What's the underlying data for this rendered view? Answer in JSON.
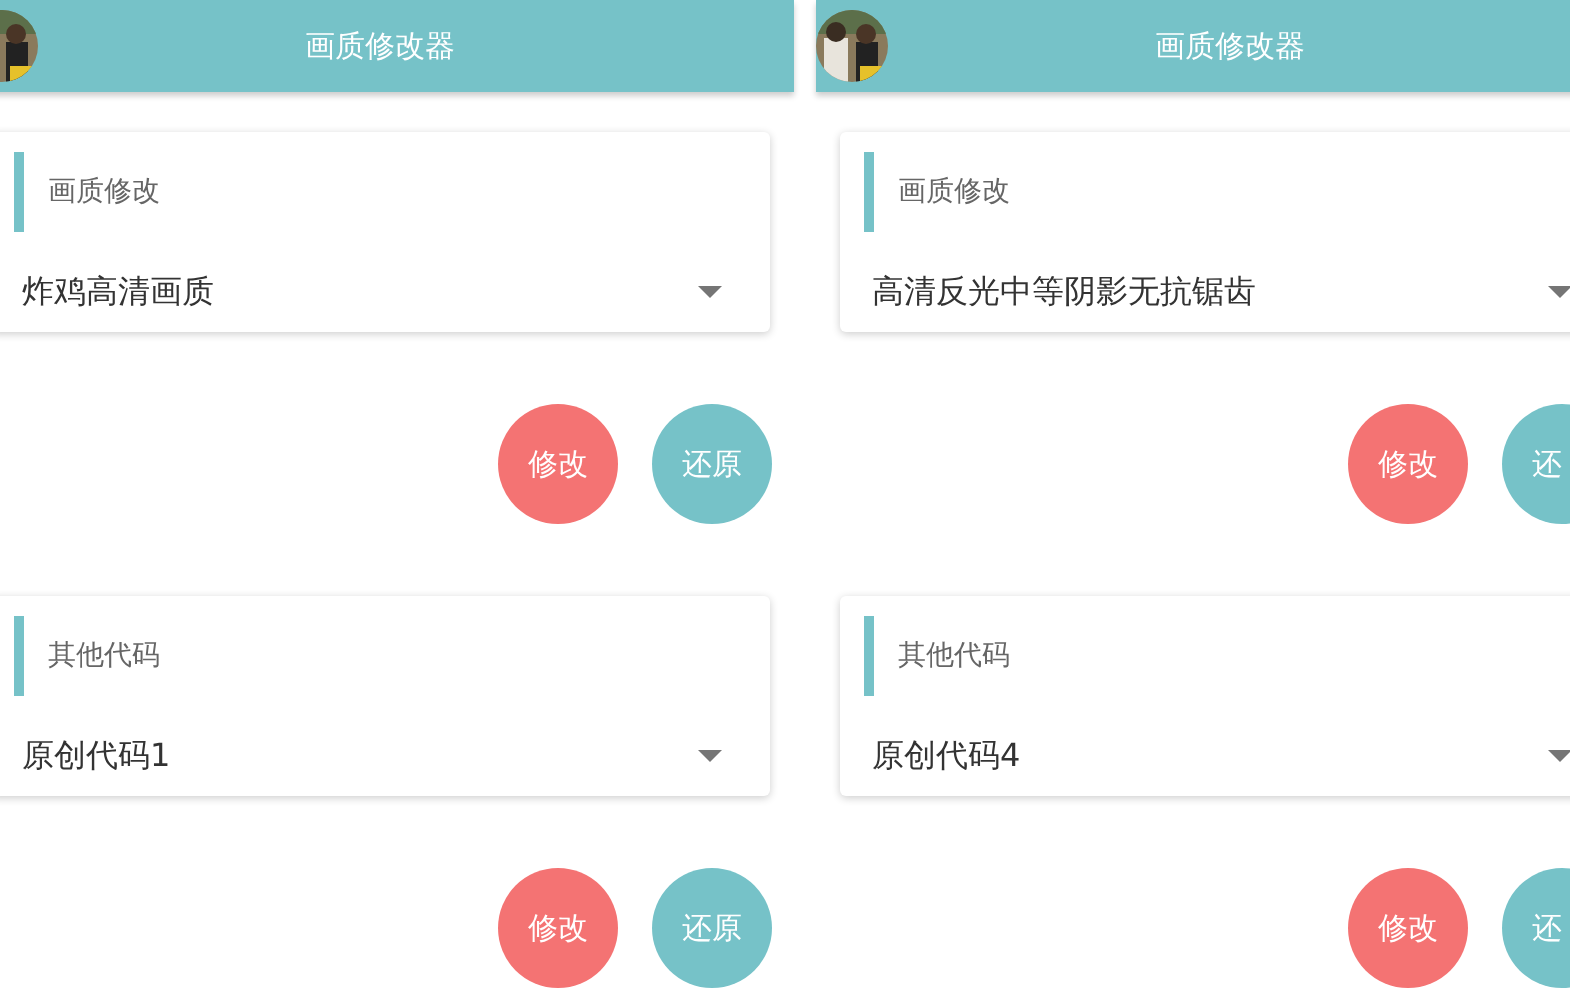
{
  "panes": [
    {
      "title": "画质修改器",
      "sections": [
        {
          "heading": "画质修改",
          "value": "炸鸡高清画质",
          "buttons": [
            {
              "label": "修改",
              "kind": "apply"
            },
            {
              "label": "还原",
              "kind": "restore"
            }
          ]
        },
        {
          "heading": "其他代码",
          "value": "原创代码1",
          "buttons": [
            {
              "label": "修改",
              "kind": "apply"
            },
            {
              "label": "还原",
              "kind": "restore"
            }
          ]
        }
      ]
    },
    {
      "title": "画质修改器",
      "sections": [
        {
          "heading": "画质修改",
          "value": "高清反光中等阴影无抗锯齿",
          "buttons": [
            {
              "label": "修改",
              "kind": "apply"
            },
            {
              "label": "还",
              "kind": "restore"
            }
          ]
        },
        {
          "heading": "其他代码",
          "value": "原创代码4",
          "buttons": [
            {
              "label": "修改",
              "kind": "apply"
            },
            {
              "label": "还",
              "kind": "restore"
            }
          ]
        }
      ]
    }
  ]
}
